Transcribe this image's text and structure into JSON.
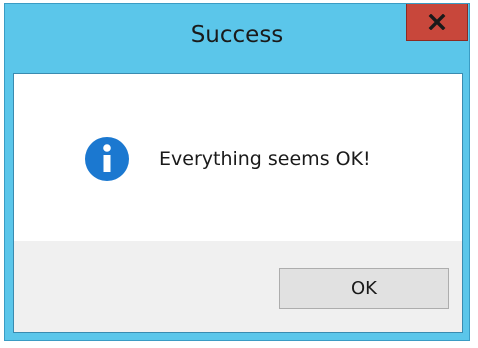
{
  "window": {
    "title": "Success",
    "close_icon": "close-x-icon",
    "colors": {
      "frame": "#5bc6ea",
      "close_button": "#c8473b",
      "content_bg": "#ffffff",
      "footer_bg": "#f0f0f0",
      "info_icon": "#1b78d0"
    }
  },
  "dialog": {
    "icon": "info-icon",
    "message": "Everything seems OK!"
  },
  "buttons": {
    "ok_label": "OK"
  }
}
